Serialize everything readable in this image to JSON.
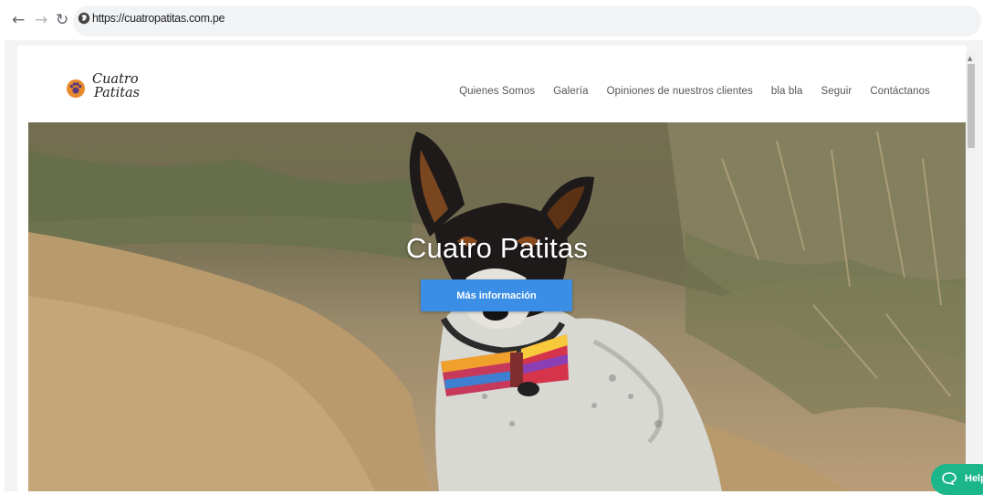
{
  "browser": {
    "url": "https://cuatropatitas.com.pe",
    "back_icon": "arrow-left-icon",
    "forward_icon": "arrow-right-icon",
    "reload_icon": "reload-icon",
    "site_icon": "globe-icon"
  },
  "site": {
    "logo": {
      "line1": "Cuatro",
      "line2": "Patitas",
      "icon": "paw-icon"
    },
    "nav": [
      {
        "label": "Quienes Somos"
      },
      {
        "label": "Galería"
      },
      {
        "label": "Opiniones de nuestros clientes"
      },
      {
        "label": "bla bla"
      },
      {
        "label": "Seguir"
      },
      {
        "label": "Contáctanos"
      }
    ],
    "hero": {
      "title": "Cuatro Patitas",
      "button_label": "Más información"
    }
  },
  "help": {
    "label": "Help",
    "icon": "chat-bubble-icon"
  },
  "colors": {
    "accent": "#3a8ee6",
    "help_green": "#1cb68b",
    "logo_orange": "#e8892b"
  }
}
